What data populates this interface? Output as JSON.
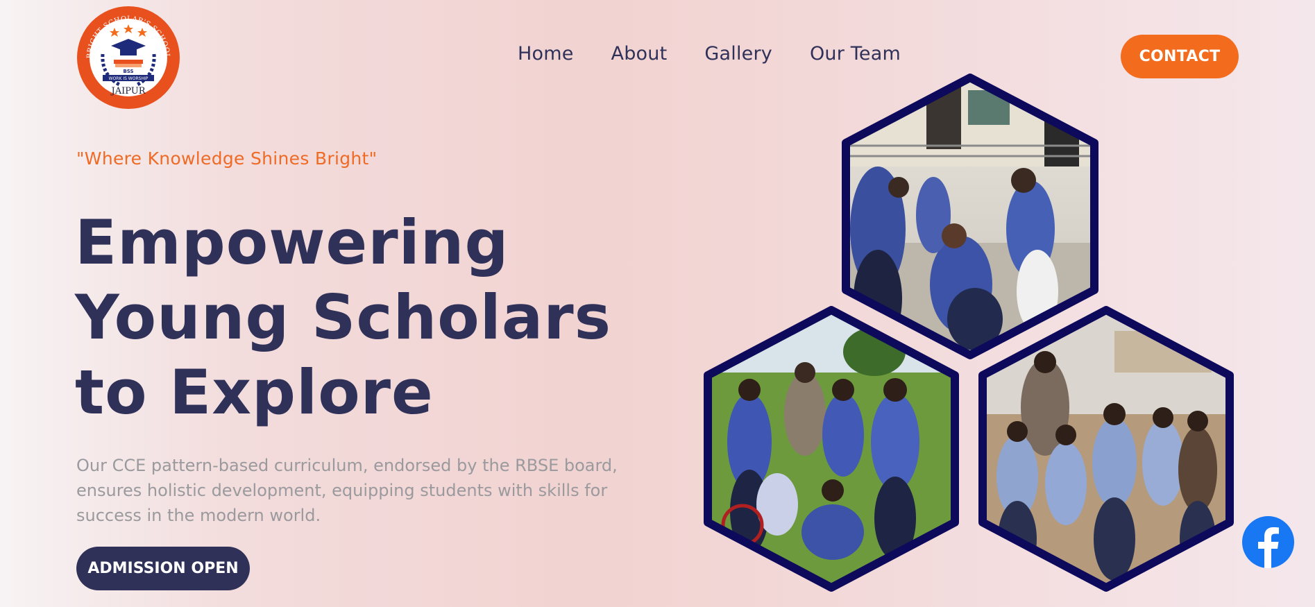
{
  "logo": {
    "top_text": "BRIGHT SCHOLAR'S SCHOOL",
    "initials": "BSS",
    "motto": "WORK IS WORSHIP",
    "city": "JAIPUR"
  },
  "nav": {
    "items": [
      {
        "label": "Home"
      },
      {
        "label": "About"
      },
      {
        "label": "Gallery"
      },
      {
        "label": "Our Team"
      }
    ]
  },
  "contact_button": "CONTACT",
  "hero": {
    "tagline": "\"Where Knowledge Shines Bright\"",
    "headline_lines": [
      "Empowering",
      "Young Scholars",
      "to Explore"
    ],
    "description": "Our CCE pattern-based curriculum, endorsed by the RBSE board, ensures holistic development, equipping students with skills for success in the modern world.",
    "admission_button": "ADMISSION OPEN"
  },
  "gallery": {
    "photos": [
      {
        "name": "students-stretching-photo"
      },
      {
        "name": "students-with-racket-photo"
      },
      {
        "name": "students-group-photo"
      }
    ]
  },
  "social": {
    "icon": "facebook-icon"
  },
  "colors": {
    "navy": "#2f3159",
    "accent_orange": "#f36c1d",
    "hex_border": "#0d0a5c",
    "facebook_blue": "#1877f2"
  }
}
